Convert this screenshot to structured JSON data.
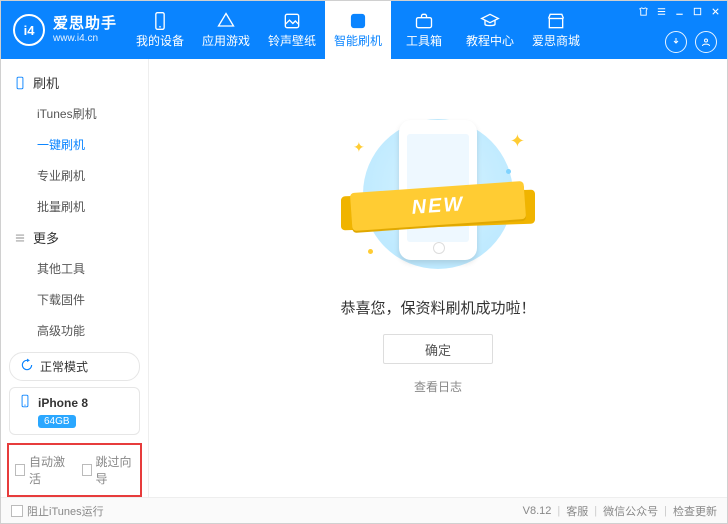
{
  "brand": {
    "logo_text": "i4",
    "title": "爱思助手",
    "subtitle": "www.i4.cn"
  },
  "nav": [
    {
      "label": "我的设备"
    },
    {
      "label": "应用游戏"
    },
    {
      "label": "铃声壁纸"
    },
    {
      "label": "智能刷机",
      "active": true
    },
    {
      "label": "工具箱"
    },
    {
      "label": "教程中心"
    },
    {
      "label": "爱思商城"
    }
  ],
  "sidebar": {
    "sections": [
      {
        "title": "刷机",
        "icon": "phone",
        "items": [
          {
            "label": "iTunes刷机"
          },
          {
            "label": "一键刷机",
            "active": true
          },
          {
            "label": "专业刷机"
          },
          {
            "label": "批量刷机"
          }
        ]
      },
      {
        "title": "更多",
        "icon": "menu",
        "items": [
          {
            "label": "其他工具"
          },
          {
            "label": "下载固件"
          },
          {
            "label": "高级功能"
          }
        ]
      }
    ],
    "mode": {
      "label": "正常模式"
    },
    "device": {
      "name": "iPhone 8",
      "storage": "64GB"
    },
    "checks": {
      "auto_activate": "自动激活",
      "skip_guide": "跳过向导"
    }
  },
  "main": {
    "ribbon": "NEW",
    "message": "恭喜您，保资料刷机成功啦！",
    "ok": "确定",
    "log": "查看日志"
  },
  "footer": {
    "block_itunes": "阻止iTunes运行",
    "version": "V8.12",
    "support": "客服",
    "wechat": "微信公众号",
    "update": "检查更新"
  }
}
